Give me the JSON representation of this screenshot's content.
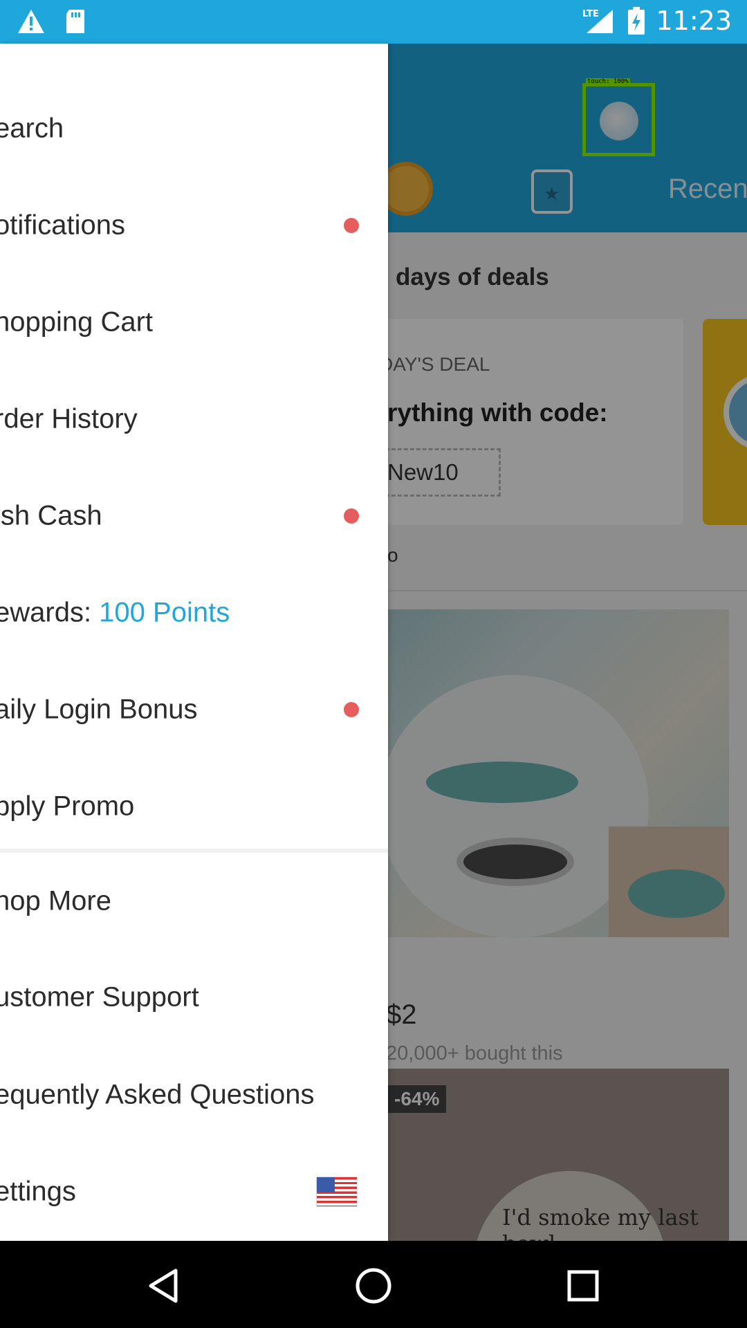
{
  "status_bar": {
    "time": "11:23",
    "network": "LTE",
    "icons": [
      "warning-icon",
      "sd-card-icon",
      "signal-icon",
      "battery-charging-icon"
    ]
  },
  "background": {
    "header_tab_recent": "Recen",
    "touch_label": "touch: 100%",
    "deals_title": "days of deals",
    "deal_eyebrow": "DAY'S DEAL",
    "deal_text": "rything with code:",
    "deal_code": "New10",
    "deal_footer": "o",
    "product1_price": "$2",
    "product1_bought": "20,000+ bought this",
    "product2_badge": "-64%",
    "product2_tag_text": "I'd smoke my last bowl"
  },
  "drawer": {
    "items": [
      {
        "label": "earch",
        "has_dot": false
      },
      {
        "label": "otifications",
        "has_dot": true
      },
      {
        "label": "nopping Cart",
        "has_dot": false
      },
      {
        "label": "rder History",
        "has_dot": false
      },
      {
        "label": "ish Cash",
        "has_dot": true
      },
      {
        "label_prefix": "ewards: ",
        "label_points": "100 Points",
        "has_dot": false
      },
      {
        "label": "aily Login Bonus",
        "has_dot": true
      },
      {
        "label": "pply Promo",
        "has_dot": false
      },
      {
        "label": "nop More",
        "has_dot": false
      },
      {
        "label": "ustomer Support",
        "has_dot": false
      },
      {
        "label": "equently Asked Questions",
        "has_dot": false
      },
      {
        "label": "ettings",
        "has_flag": true
      }
    ]
  },
  "colors": {
    "accent": "#1fa7dc",
    "notification_dot": "#e55d5d",
    "text": "#2b2b2b"
  },
  "nav_bar": {
    "icons": [
      "back-icon",
      "home-icon",
      "recents-icon"
    ]
  }
}
